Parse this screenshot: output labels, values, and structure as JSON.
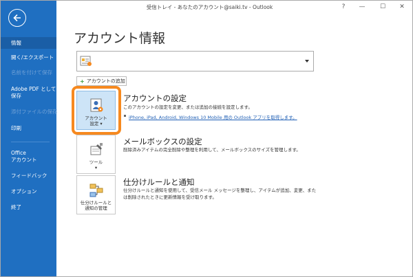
{
  "window": {
    "title": "受信トレイ - あなたのアカウント@saiki.tv - Outlook",
    "help": "?",
    "minimize": "—",
    "maximize": "☐",
    "close": "✕"
  },
  "sidebar": {
    "items": [
      {
        "label": "情報",
        "state": "active"
      },
      {
        "label": "開く/エクスポート",
        "state": "normal"
      },
      {
        "label": "名前を付けて保存",
        "state": "disabled"
      },
      {
        "label": "Adobe PDF として",
        "label2": "保存",
        "state": "normal"
      },
      {
        "label": "添付ファイルの保存",
        "state": "disabled"
      },
      {
        "label": "印刷",
        "state": "normal"
      },
      {
        "label": "Office",
        "label2": "アカウント",
        "state": "normal"
      },
      {
        "label": "フィードバック",
        "state": "normal"
      },
      {
        "label": "オプション",
        "state": "normal"
      },
      {
        "label": "終了",
        "state": "normal"
      }
    ]
  },
  "main": {
    "title": "アカウント情報",
    "add_account_label": "アカウントの追加",
    "sections": [
      {
        "tile_label": "アカウント",
        "tile_label2": "設定 ▾",
        "title": "アカウントの設定",
        "desc": "このアカウントの設定を変更、または追加の接続を設定します。",
        "link": "iPhone, iPad, Android, Windows 10 Mobile 用の Outlook アプリを取得します。"
      },
      {
        "tile_label": "ツール",
        "tile_label2": "▾",
        "title": "メールボックスの設定",
        "desc": "削除済みアイテムの完全削除や整理を利用して、メールボックスのサイズを管理します。"
      },
      {
        "tile_label": "仕分けルールと",
        "tile_label2": "通知の管理",
        "title": "仕分けルールと通知",
        "desc": "仕分けルールと通知を使用して、受信メール メッセージを整理し、アイテムが追加、変更、また",
        "desc2": "は削除されたときに更新情報を受け取ります。"
      }
    ]
  },
  "colors": {
    "sidebar_bg": "#1f6fc1",
    "highlight": "#f6891f",
    "link": "#1f5fb5"
  }
}
